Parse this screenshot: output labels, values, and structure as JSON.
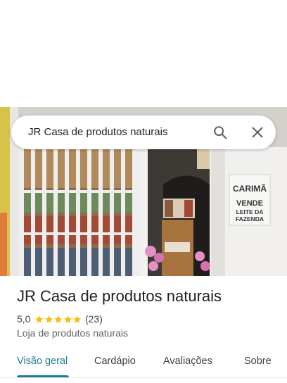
{
  "search": {
    "query": "JR Casa de produtos naturais"
  },
  "place": {
    "name": "JR Casa de produtos naturais",
    "rating": "5,0",
    "stars": 5,
    "reviews_count": "(23)",
    "category": "Loja de produtos naturais"
  },
  "photo_sign": {
    "line1": "CARIMÃ",
    "line2": "VENDE",
    "line3": "LEITE DA",
    "line4": "FAZENDA"
  },
  "tabs": [
    {
      "label": "Visão geral",
      "active": true
    },
    {
      "label": "Cardápio",
      "active": false
    },
    {
      "label": "Avaliações",
      "active": false
    },
    {
      "label": "Sobre",
      "active": false
    }
  ],
  "colors": {
    "accent": "#1a7f8e",
    "star": "#fbbc04",
    "text": "#202124"
  }
}
